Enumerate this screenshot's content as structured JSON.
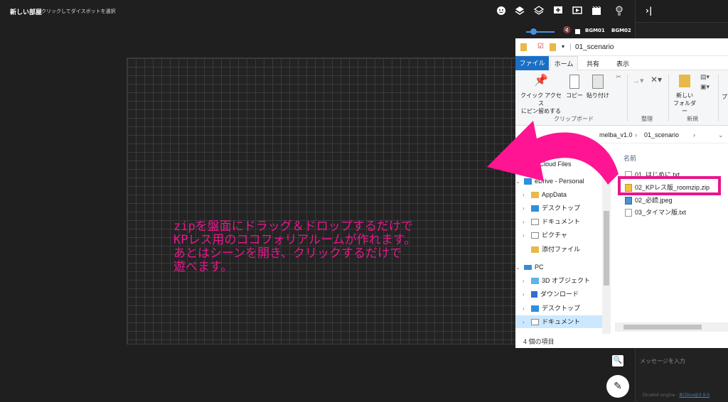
{
  "header": {
    "room_title": "新しい部屋",
    "hint": "クリックしてダイスボットを選択"
  },
  "audio": {
    "bgm1": "BGM01",
    "bgm2": "BGM02",
    "volume_level": 0.4
  },
  "caption": {
    "lines": [
      "zipを盤面にドラッグ＆ドロップするだけで",
      "KPレス用のココフォリアルームが作れます。",
      "あとはシーンを開き、クリックするだけで",
      "遊べます。"
    ]
  },
  "explorer": {
    "title": "01_scenario",
    "tabs": {
      "file": "ファイル",
      "home": "ホーム",
      "share": "共有",
      "view": "表示"
    },
    "ribbon": {
      "pin_label_1": "クイック アクセス",
      "pin_label_2": "にピン留めする",
      "copy": "コピー",
      "paste": "貼り付け",
      "clipboard_group": "クリップボード",
      "organize_group": "整理",
      "new_folder_1": "新しい",
      "new_folder_2": "フォルダー",
      "new_group": "新規",
      "extra": "プ"
    },
    "address": {
      "parent": "melba_v1.0",
      "sep": "›",
      "current": "01_scenario"
    },
    "column_name": "名前",
    "nav": [
      {
        "label": "ative Cloud Files",
        "icon": "creative-cloud-icon",
        "level": 0
      },
      {
        "label": "eDrive - Personal",
        "icon": "onedrive-icon",
        "level": 0
      },
      {
        "label": "AppData",
        "icon": "folder-icon",
        "level": 1
      },
      {
        "label": "デスクトップ",
        "icon": "desktop-icon",
        "level": 1
      },
      {
        "label": "ドキュメント",
        "icon": "document-icon",
        "level": 1
      },
      {
        "label": "ピクチャ",
        "icon": "pictures-icon",
        "level": 1
      },
      {
        "label": "添付ファイル",
        "icon": "folder-icon",
        "level": 1
      },
      {
        "label": "PC",
        "icon": "pc-icon",
        "level": 0
      },
      {
        "label": "3D オブジェクト",
        "icon": "3d-objects-icon",
        "level": 1
      },
      {
        "label": "ダウンロード",
        "icon": "download-icon",
        "level": 1
      },
      {
        "label": "デスクトップ",
        "icon": "desktop-icon",
        "level": 1
      },
      {
        "label": "ドキュメント",
        "icon": "document-icon",
        "level": 1
      }
    ],
    "files": [
      {
        "name": "01_はじめに.txt",
        "type": "txt"
      },
      {
        "name": "02_KPレス版_roomzip.zip",
        "type": "zip",
        "highlighted": true
      },
      {
        "name": "02_必読.jpeg",
        "type": "jpeg"
      },
      {
        "name": "03_タイマン版.txt",
        "type": "txt"
      }
    ],
    "status": "4 個の項目"
  },
  "sidebar": {
    "message_placeholder": "メッセージを入力",
    "engine_prefix": "Dicebot engine : ",
    "engine_link": "BCDice@3.9.0"
  },
  "colors": {
    "accent": "#e8168c",
    "background": "#1f1f1f",
    "explorer_file_tab": "#1a6fc4"
  }
}
